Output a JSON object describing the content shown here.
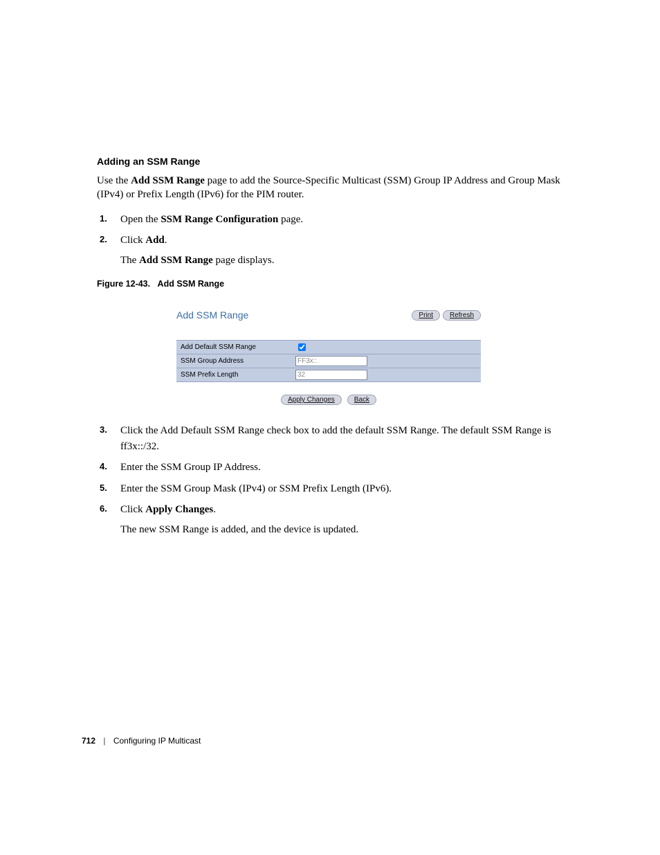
{
  "section_heading": "Adding an SSM Range",
  "intro_prefix": "Use the ",
  "intro_bold1": "Add SSM Range",
  "intro_suffix": " page to add the Source-Specific Multicast (SSM) Group IP Address and Group Mask (IPv4) or Prefix Length (IPv6) for the PIM router.",
  "steps_top": {
    "s1_a": "Open the ",
    "s1_b": "SSM Range Configuration",
    "s1_c": " page.",
    "s2_a": "Click ",
    "s2_b": "Add",
    "s2_c": ".",
    "s2_sub_a": "The ",
    "s2_sub_b": "Add SSM Range",
    "s2_sub_c": " page displays."
  },
  "figure_caption_prefix": "Figure 12-43.",
  "figure_caption_title": "Add SSM Range",
  "figure": {
    "title": "Add SSM Range",
    "print": "Print",
    "refresh": "Refresh",
    "row1_label": "Add Default SSM Range",
    "row2_label": "SSM Group Address",
    "row2_value": "FF3x::",
    "row3_label": "SSM Prefix Length",
    "row3_value": "32",
    "apply": "Apply Changes",
    "back": "Back"
  },
  "steps_bottom": {
    "s3": "Click the Add Default SSM Range check box to add the default SSM Range. The default SSM Range is ff3x::/32.",
    "s4": "Enter the SSM Group IP Address.",
    "s5": "Enter the SSM Group Mask (IPv4) or SSM Prefix Length (IPv6).",
    "s6_a": "Click ",
    "s6_b": "Apply Changes",
    "s6_c": ".",
    "s6_sub": "The new SSM Range is added, and the device is updated."
  },
  "footer": {
    "page_num": "712",
    "chapter": "Configuring IP Multicast"
  }
}
